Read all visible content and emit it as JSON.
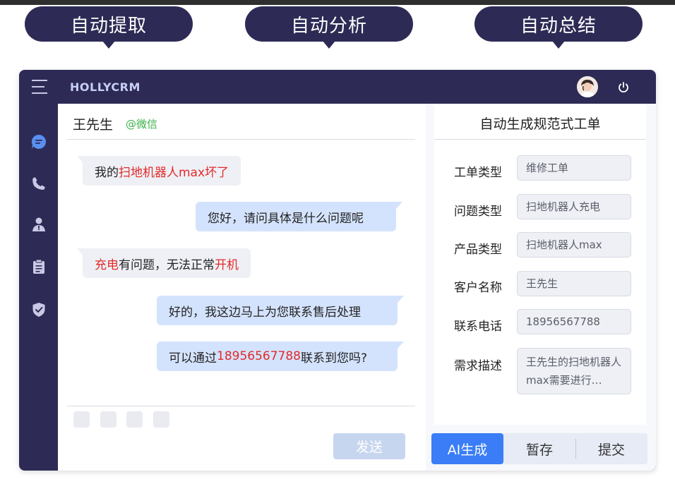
{
  "banners": {
    "extract": "自动提取",
    "analyze": "自动分析",
    "summarize": "自动总结"
  },
  "app": {
    "brand": "HOLLYCRM"
  },
  "chat": {
    "contact_name": "王先生",
    "channel": "@微信",
    "messages": [
      {
        "side": "left",
        "parts": [
          "我的",
          "扫地机器人max坏了"
        ]
      },
      {
        "side": "right",
        "text": "您好，请问具体是什么问题呢"
      },
      {
        "side": "left",
        "parts": [
          "充电",
          "有问题，无法正常",
          "开机"
        ]
      },
      {
        "side": "right",
        "text": "好的，我这边马上为您联系售后处理"
      },
      {
        "side": "right",
        "parts": [
          "可以通过",
          "18956567788",
          "联系到您吗?"
        ]
      }
    ],
    "send_label": "发送"
  },
  "ticket": {
    "title": "自动生成规范式工单",
    "fields": [
      {
        "label": "工单类型",
        "value": "维修工单"
      },
      {
        "label": "问题类型",
        "value": "扫地机器人充电"
      },
      {
        "label": "产品类型",
        "value": "扫地机器人max"
      },
      {
        "label": "客户名称",
        "value": "王先生"
      },
      {
        "label": "联系电话",
        "value": "18956567788"
      },
      {
        "label": "需求描述",
        "value": "王先生的扫地机器人max需要进行…"
      }
    ],
    "actions": {
      "ai": "AI生成",
      "save": "暂存",
      "submit": "提交"
    }
  },
  "colors": {
    "nav_bg": "#2d2b55",
    "accent_blue": "#3a7df6",
    "highlight_red": "#e32a2a",
    "channel_green": "#39b04a"
  }
}
